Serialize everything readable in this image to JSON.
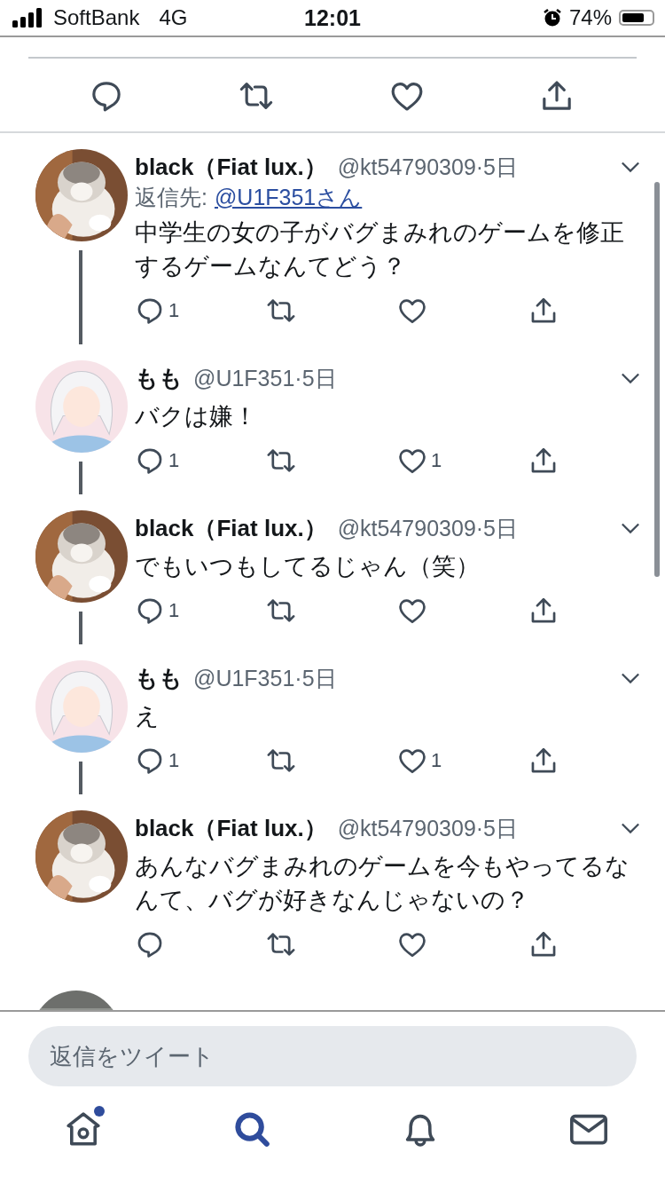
{
  "status_bar": {
    "carrier": "SoftBank",
    "network": "4G",
    "time": "12:01",
    "battery": "74%"
  },
  "tweets": [
    {
      "kind": "dog",
      "name": "black（Fiat lux.）",
      "handle_time": "@kt54790309·5日",
      "reply_label": "返信先:",
      "reply_link": "@U1F351さん",
      "text": "中学生の女の子がバグまみれのゲームを修正するゲームなんてどう？",
      "replies": "1",
      "thread_continues": true
    },
    {
      "kind": "girl",
      "name": "もも",
      "handle_time": "@U1F351·5日",
      "text": "バクは嫌！",
      "replies": "1",
      "likes": "1",
      "thread_continues": true
    },
    {
      "kind": "dog",
      "name": "black（Fiat lux.）",
      "handle_time": "@kt54790309·5日",
      "text": "でもいつもしてるじゃん（笑）",
      "replies": "1",
      "thread_continues": true
    },
    {
      "kind": "girl",
      "name": "もも",
      "handle_time": "@U1F351·5日",
      "text": "え",
      "replies": "1",
      "likes": "1",
      "thread_continues": true
    },
    {
      "kind": "dog",
      "name": "black（Fiat lux.）",
      "handle_time": "@kt54790309·5日",
      "text": "あんなバグまみれのゲームを今もやってるなんて、バグが好きなんじゃないの？",
      "thread_continues": false
    }
  ],
  "compose": {
    "placeholder": "返信をツイート"
  },
  "nav": [
    {
      "kind": "home",
      "selected": false,
      "badge": true
    },
    {
      "kind": "search",
      "selected": true,
      "badge": false
    },
    {
      "kind": "bell",
      "selected": false,
      "badge": false
    },
    {
      "kind": "mail",
      "selected": false,
      "badge": false
    }
  ]
}
